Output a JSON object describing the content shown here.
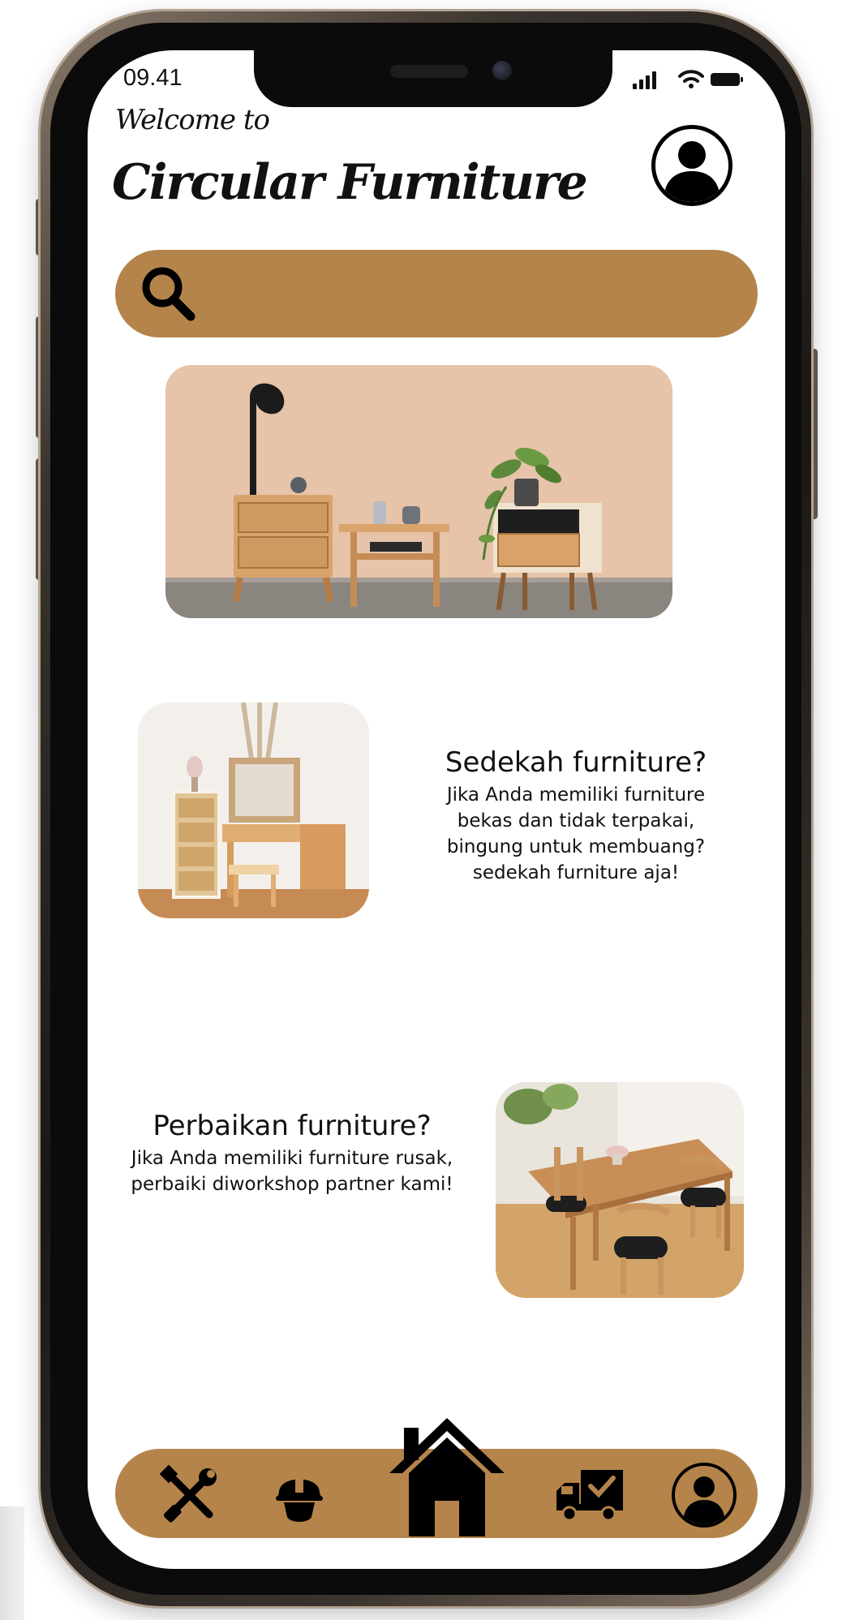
{
  "status_bar": {
    "time": "09.41"
  },
  "header": {
    "welcome": "Welcome to",
    "title": "Circular Furniture"
  },
  "search": {
    "placeholder": "",
    "value": ""
  },
  "hero": {
    "alt": "Furniture showcase"
  },
  "features": [
    {
      "title": "Sedekah furniture?",
      "description": "Jika Anda memiliki furniture bekas dan tidak terpakai, bingung untuk membuang? sedekah furniture aja!"
    },
    {
      "title": "Perbaikan furniture?",
      "description": "Jika Anda memiliki furniture rusak, perbaiki diworkshop partner kami!"
    }
  ],
  "bottom_nav": {
    "items": [
      {
        "icon": "tools-icon"
      },
      {
        "icon": "helmet-icon"
      },
      {
        "icon": "home-icon",
        "active": true
      },
      {
        "icon": "delivery-truck-icon"
      },
      {
        "icon": "profile-icon"
      }
    ]
  },
  "colors": {
    "accent": "#b5844a",
    "text": "#111111",
    "background": "#ffffff"
  }
}
